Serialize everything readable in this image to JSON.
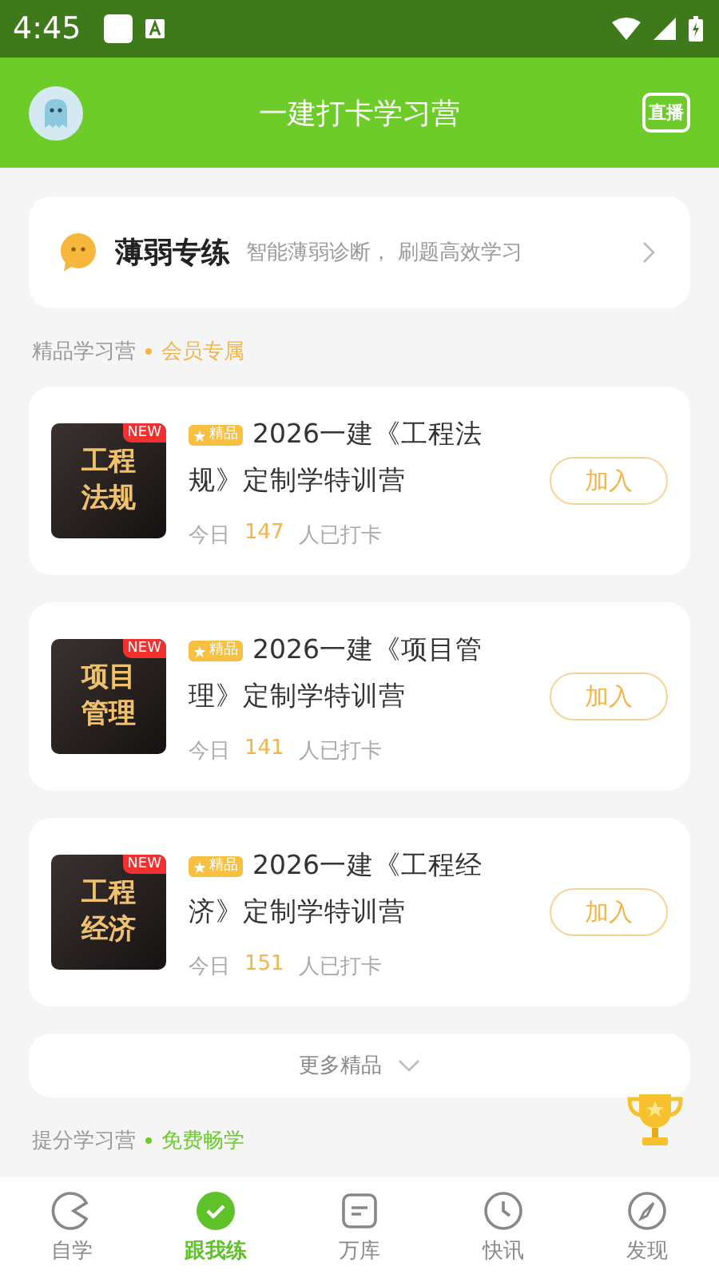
{
  "status_bar": {
    "time": "4:45"
  },
  "header": {
    "title": "一建打卡学习营",
    "live_badge": "直播"
  },
  "weak_practice": {
    "title": "薄弱专练",
    "subtitle": "智能薄弱诊断，  刷题高效学习"
  },
  "premium_section": {
    "title": "精品学习营",
    "tag": "会员专属"
  },
  "camps": [
    {
      "cover_text": "工程法规",
      "new_badge": "NEW",
      "tag": "精品",
      "title_lines": [
        "2026一建《工程法",
        "规》定制学特训营"
      ],
      "today": "今日",
      "count": "147",
      "suffix": "人已打卡",
      "button": "加入"
    },
    {
      "cover_text": "项目管理",
      "new_badge": "NEW",
      "tag": "精品",
      "title_lines": [
        "2026一建《项目管",
        "理》定制学特训营"
      ],
      "today": "今日",
      "count": "141",
      "suffix": "人已打卡",
      "button": "加入"
    },
    {
      "cover_text": "工程经济",
      "new_badge": "NEW",
      "tag": "精品",
      "title_lines": [
        "2026一建《工程经",
        "济》定制学特训营"
      ],
      "today": "今日",
      "count": "151",
      "suffix": "人已打卡",
      "button": "加入"
    }
  ],
  "more_button": "更多精品",
  "free_section": {
    "title": "提分学习营",
    "tag": "免费畅学"
  },
  "tab_bar": [
    {
      "label": "自学",
      "selected": false
    },
    {
      "label": "跟我练",
      "selected": true
    },
    {
      "label": "万库",
      "selected": false
    },
    {
      "label": "快讯",
      "selected": false
    },
    {
      "label": "发现",
      "selected": false
    }
  ]
}
